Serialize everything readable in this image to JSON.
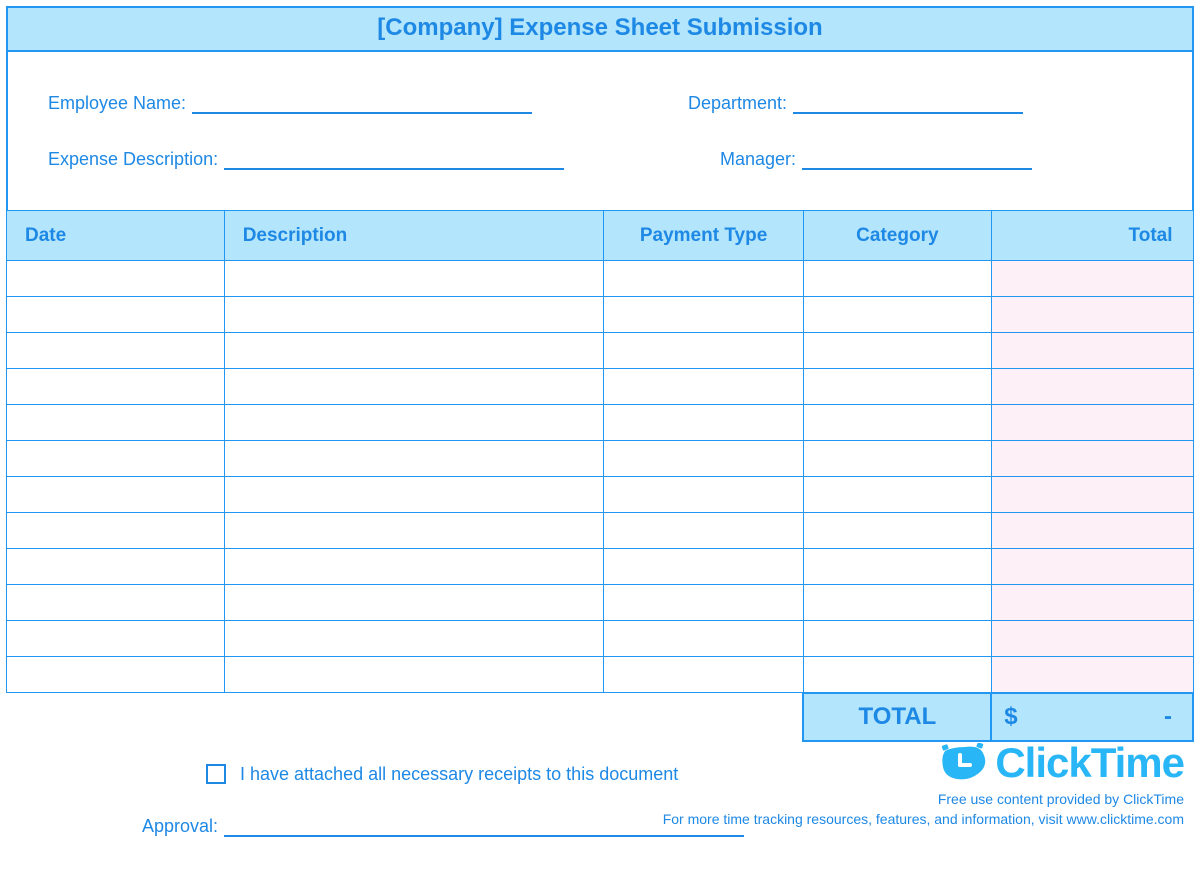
{
  "title": "[Company] Expense Sheet Submission",
  "fields": {
    "employee_name_label": "Employee Name:",
    "department_label": "Department:",
    "expense_description_label": "Expense Description:",
    "manager_label": "Manager:",
    "approval_label": "Approval:"
  },
  "columns": {
    "date": "Date",
    "description": "Description",
    "payment_type": "Payment Type",
    "category": "Category",
    "total": "Total"
  },
  "rows": [
    {
      "date": "",
      "description": "",
      "payment_type": "",
      "category": "",
      "total": ""
    },
    {
      "date": "",
      "description": "",
      "payment_type": "",
      "category": "",
      "total": ""
    },
    {
      "date": "",
      "description": "",
      "payment_type": "",
      "category": "",
      "total": ""
    },
    {
      "date": "",
      "description": "",
      "payment_type": "",
      "category": "",
      "total": ""
    },
    {
      "date": "",
      "description": "",
      "payment_type": "",
      "category": "",
      "total": ""
    },
    {
      "date": "",
      "description": "",
      "payment_type": "",
      "category": "",
      "total": ""
    },
    {
      "date": "",
      "description": "",
      "payment_type": "",
      "category": "",
      "total": ""
    },
    {
      "date": "",
      "description": "",
      "payment_type": "",
      "category": "",
      "total": ""
    },
    {
      "date": "",
      "description": "",
      "payment_type": "",
      "category": "",
      "total": ""
    },
    {
      "date": "",
      "description": "",
      "payment_type": "",
      "category": "",
      "total": ""
    },
    {
      "date": "",
      "description": "",
      "payment_type": "",
      "category": "",
      "total": ""
    },
    {
      "date": "",
      "description": "",
      "payment_type": "",
      "category": "",
      "total": ""
    }
  ],
  "grand_total": {
    "label": "TOTAL",
    "currency": "$",
    "amount": "-"
  },
  "receipts_confirmation": "I have attached all necessary receipts to this document",
  "branding": {
    "logo_text": "ClickTime",
    "line1": "Free use content provided by ClickTime",
    "line2": "For more time tracking resources, features, and information, visit www.clicktime.com"
  }
}
